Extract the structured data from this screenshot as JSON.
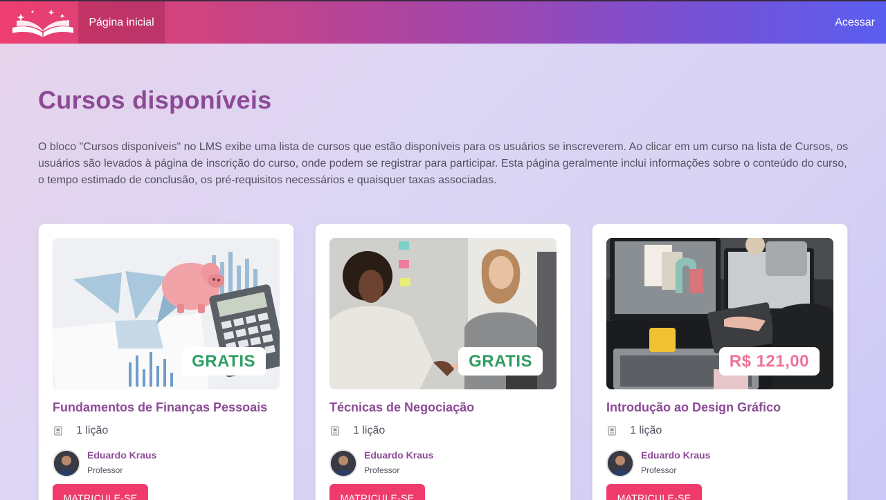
{
  "header": {
    "logo_icon": "open-book-icon",
    "nav_home": "Página inicial",
    "login": "Acessar"
  },
  "main": {
    "title": "Cursos disponíveis",
    "intro": "O bloco \"Cursos disponíveis\" no LMS exibe uma lista de cursos que estão disponíveis para os usuários se inscreverem. Ao clicar em um curso na lista de Cursos, os usuários são levados à página de inscrição do curso, onde podem se registrar para participar. Esta página geralmente inclui informações sobre o conteúdo do curso, o tempo estimado de conclusão, os pré-requisitos necessários e quaisquer taxas associadas."
  },
  "courses": [
    {
      "title": "Fundamentos de Finanças Pessoais",
      "price": "GRATIS",
      "lessons": "1 lição",
      "author": "Eduardo Kraus",
      "role": "Professor",
      "enroll": "MATRICULE-SE"
    },
    {
      "title": "Técnicas de Negociação",
      "price": "GRATIS",
      "lessons": "1 lição",
      "author": "Eduardo Kraus",
      "role": "Professor",
      "enroll": "MATRICULE-SE"
    },
    {
      "title": "Introdução ao Design Gráfico",
      "price": "R$ 121,00",
      "lessons": "1 lição",
      "author": "Eduardo Kraus",
      "role": "Professor",
      "enroll": "MATRICULE-SE"
    }
  ],
  "colors": {
    "accent": "#8c4a96",
    "button": "#ee3b6c",
    "free_price": "#2e9e62",
    "paid_price": "#ee7497"
  }
}
